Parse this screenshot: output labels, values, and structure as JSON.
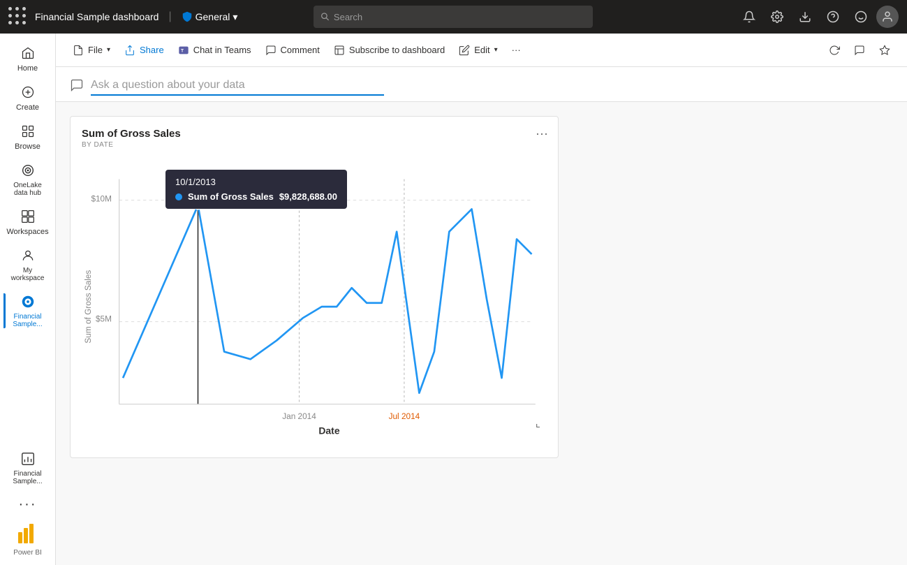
{
  "topbar": {
    "app_grid_label": "App grid",
    "title": "Financial Sample  dashboard",
    "divider": "|",
    "workspace": "General",
    "workspace_dropdown": "▾",
    "search_placeholder": "Search",
    "notification_icon": "bell",
    "settings_icon": "gear",
    "download_icon": "download",
    "help_icon": "question",
    "feedback_icon": "smiley",
    "avatar_icon": "user"
  },
  "sidebar": {
    "items": [
      {
        "id": "home",
        "label": "Home",
        "icon": "⌂"
      },
      {
        "id": "create",
        "label": "Create",
        "icon": "+"
      },
      {
        "id": "browse",
        "label": "Browse",
        "icon": "▦"
      },
      {
        "id": "onelake",
        "label": "OneLake data hub",
        "icon": "◎"
      },
      {
        "id": "workspaces",
        "label": "Workspaces",
        "icon": "⊞"
      },
      {
        "id": "myworkspace",
        "label": "My workspace",
        "icon": "⊙"
      },
      {
        "id": "financial",
        "label": "Financial Sample...",
        "icon": "●",
        "active": true
      }
    ],
    "more_label": "···",
    "powerbi_label": "Power BI"
  },
  "toolbar": {
    "file_label": "File",
    "file_dropdown": "▾",
    "share_label": "Share",
    "chat_label": "Chat in Teams",
    "comment_label": "Comment",
    "subscribe_label": "Subscribe to dashboard",
    "edit_label": "Edit",
    "edit_dropdown": "▾",
    "more_label": "···",
    "refresh_icon": "refresh",
    "chat_icon": "chat",
    "star_icon": "star"
  },
  "qa": {
    "placeholder": "Ask a question about your data",
    "icon": "💬"
  },
  "chart": {
    "title": "Sum of Gross Sales",
    "subtitle": "BY DATE",
    "more_icon": "···",
    "x_label": "Date",
    "y_label": "Sum of Gross Sales",
    "y_ticks": [
      "$10M",
      "$5M"
    ],
    "x_ticks": [
      "Jan 2014",
      "Jul 2014"
    ],
    "tooltip": {
      "date": "10/1/2013",
      "series_label": "Sum of Gross Sales",
      "series_value": "$9,828,688.00",
      "dot_color": "#2196f3"
    },
    "expand_icon": "⌞"
  }
}
